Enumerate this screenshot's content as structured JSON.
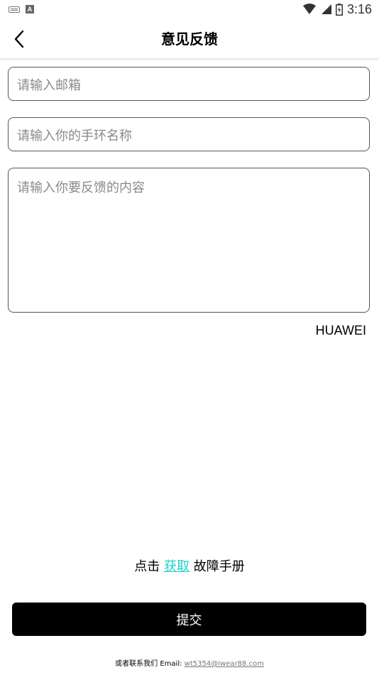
{
  "status_bar": {
    "time": "3:16",
    "icons": [
      "keyboard-icon",
      "a-icon",
      "wifi-icon",
      "signal-icon",
      "battery-icon"
    ]
  },
  "header": {
    "title": "意见反馈",
    "back_icon": "chevron-left-icon"
  },
  "form": {
    "email_placeholder": "请输入邮箱",
    "band_name_placeholder": "请输入你的手环名称",
    "feedback_placeholder": "请输入你要反馈的内容"
  },
  "brand": "HUAWEI",
  "manual": {
    "prefix": "点击",
    "link_label": "获取",
    "suffix": "故障手册"
  },
  "submit_label": "提交",
  "contact": {
    "prefix": "或者联系我们 Email:",
    "email": "wt5354@iwear88.com"
  },
  "colors": {
    "accent": "#19d3c5",
    "button_bg": "#000000",
    "border": "#555555"
  }
}
